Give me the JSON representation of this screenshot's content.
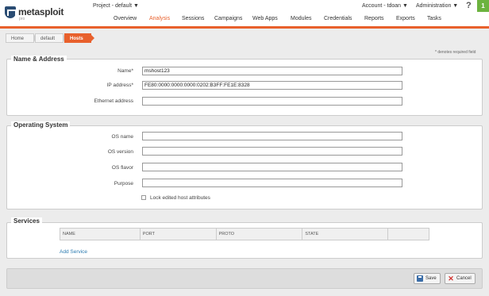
{
  "header": {
    "logo": {
      "name": "metasploit",
      "sub": "pro"
    },
    "project_label": "Project - default ▼",
    "account_label": "Account - tdoan ▼",
    "admin_label": "Administration ▼",
    "help": "?",
    "notifications": "1"
  },
  "nav": [
    {
      "label": "Overview",
      "active": false
    },
    {
      "label": "Analysis",
      "active": true
    },
    {
      "label": "Sessions",
      "active": false
    },
    {
      "label": "Campaigns",
      "active": false
    },
    {
      "label": "Web Apps",
      "active": false
    },
    {
      "label": "Modules",
      "active": false
    },
    {
      "label": "Credentials",
      "active": false
    },
    {
      "label": "Reports",
      "active": false
    },
    {
      "label": "Exports",
      "active": false
    },
    {
      "label": "Tasks",
      "active": false
    }
  ],
  "breadcrumb": [
    {
      "label": "Home"
    },
    {
      "label": "default"
    },
    {
      "label": "Hosts"
    }
  ],
  "required_note": "* denotes required field",
  "name_address": {
    "legend": "Name & Address",
    "fields": [
      {
        "label": "Name*",
        "value": "mshost123"
      },
      {
        "label": "IP address*",
        "value": "FE80:0000:0000:0000:0202:B3FF:FE1E:8328"
      },
      {
        "label": "Ethernet address",
        "value": ""
      }
    ]
  },
  "os": {
    "legend": "Operating System",
    "fields": [
      {
        "label": "OS name",
        "value": ""
      },
      {
        "label": "OS version",
        "value": ""
      },
      {
        "label": "OS flavor",
        "value": ""
      },
      {
        "label": "Purpose",
        "value": ""
      }
    ],
    "lock_label": "Lock edited host attributes"
  },
  "services": {
    "legend": "Services",
    "columns": [
      "NAME",
      "PORT",
      "PROTO",
      "STATE",
      ""
    ],
    "add_label": "Add Service"
  },
  "footer": {
    "save_label": "Save",
    "cancel_label": "Cancel"
  },
  "colors": {
    "accent": "#e8602c",
    "link": "#2a7ab0",
    "badge": "#6cb33f"
  }
}
